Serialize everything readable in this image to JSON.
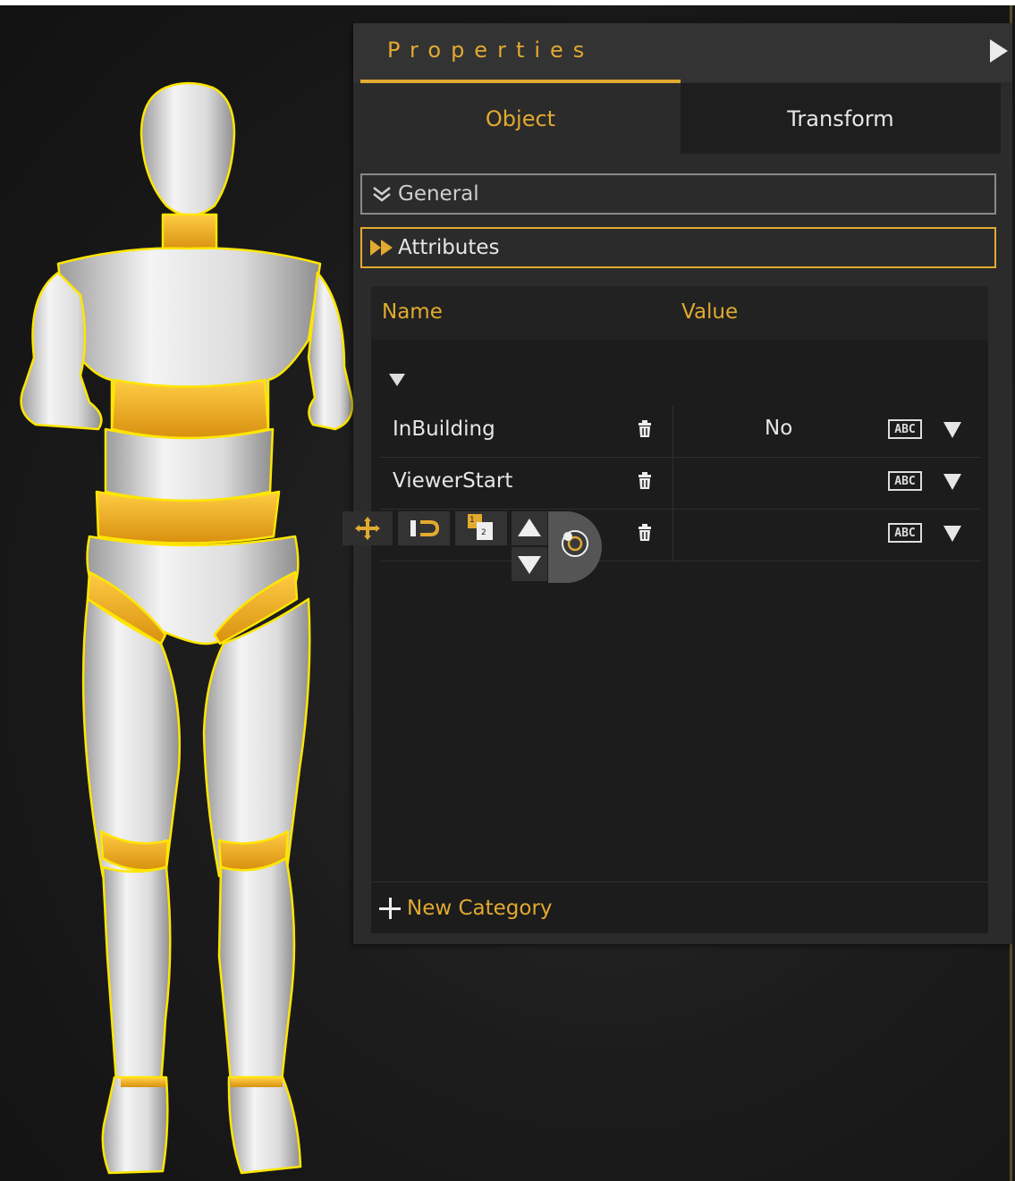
{
  "panel": {
    "title": "Properties",
    "tabs": [
      {
        "label": "Object",
        "active": true
      },
      {
        "label": "Transform",
        "active": false
      }
    ],
    "sections": [
      {
        "label": "General",
        "icon": "double-chevron-down-icon",
        "expanded": true
      },
      {
        "label": "Attributes",
        "icon": "fast-forward-icon",
        "expanded": false
      }
    ],
    "table": {
      "headers": {
        "name": "Name",
        "value": "Value"
      },
      "rows": [
        {
          "name": "InBuilding",
          "value": "No",
          "type_icon": "abc-icon"
        },
        {
          "name": "ViewerStart",
          "value": "",
          "type_icon": "abc-icon"
        },
        {
          "name": "",
          "value": "",
          "type_icon": "abc-icon"
        }
      ]
    },
    "new_category": "New Category"
  },
  "gizmo_toolbar": [
    "move-icon",
    "snap-icon",
    "layer-order-icon",
    "move-up-icon",
    "move-down-icon",
    "pivot-icon"
  ],
  "colors": {
    "accent": "#e2aa2f",
    "selection_outline": "#ffe600",
    "panel_bg": "#2b2b2b"
  }
}
